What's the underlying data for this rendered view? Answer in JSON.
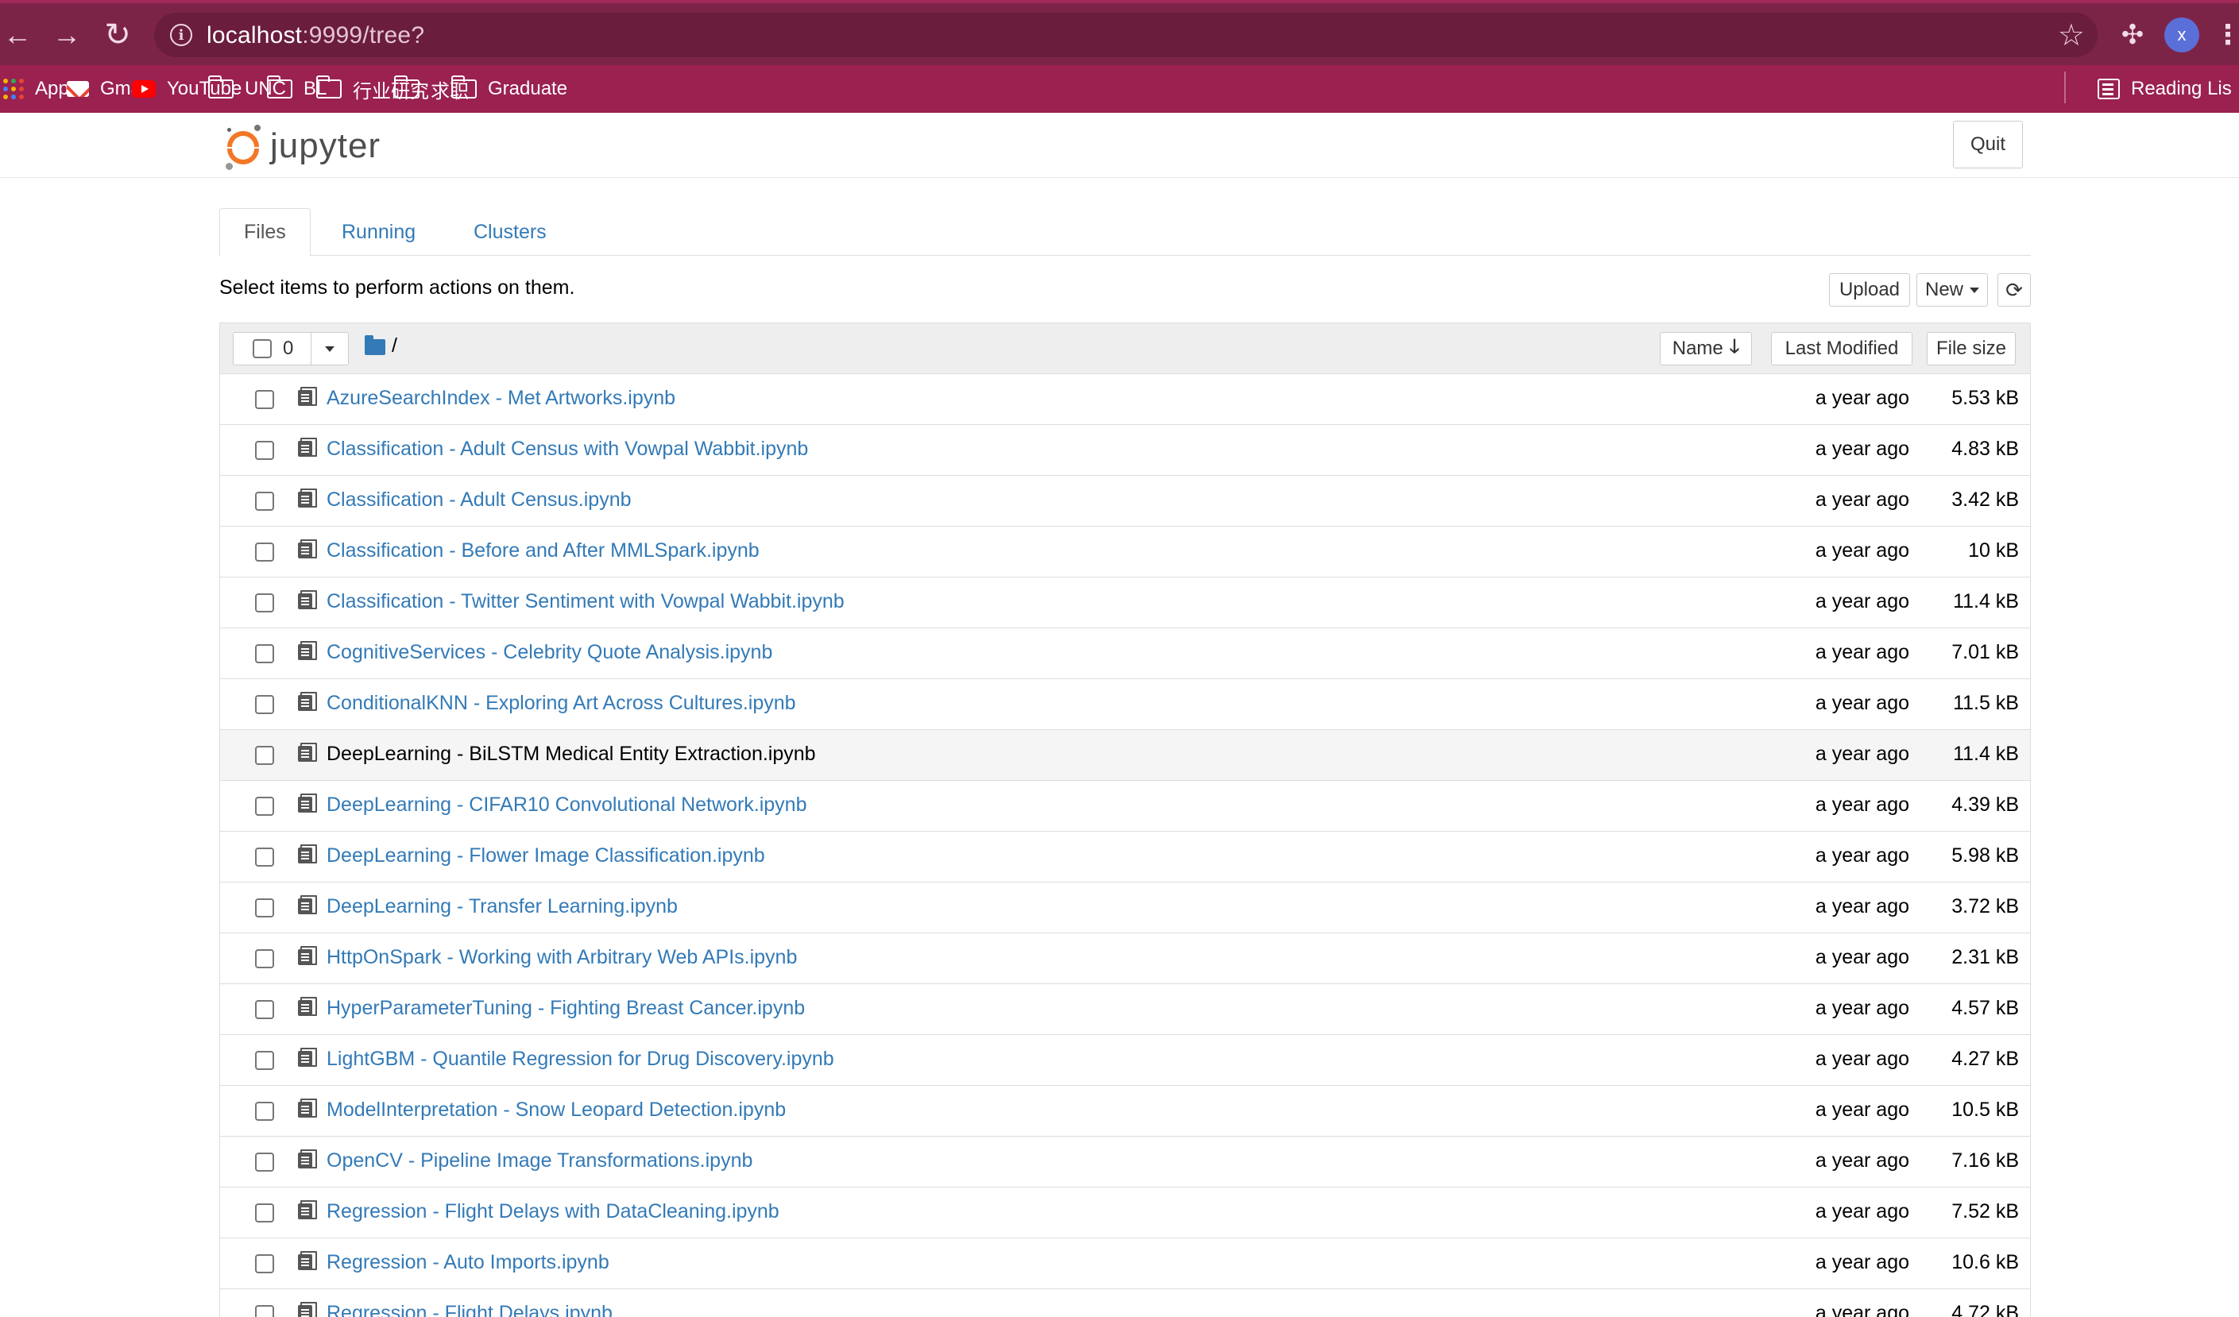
{
  "browser": {
    "url_host": "localhost",
    "url_rest": ":9999/tree?",
    "profile_initial": "x",
    "icons": [
      "back-arrow-icon",
      "forward-arrow-icon",
      "reload-icon",
      "info-icon",
      "star-icon",
      "puzzle-icon",
      "kebab-icon"
    ]
  },
  "bookmarks": [
    {
      "label": "Apps",
      "icon": "apps-grid-icon"
    },
    {
      "label": "Gmail",
      "icon": "gmail-icon"
    },
    {
      "label": "YouTube",
      "icon": "youtube-icon"
    },
    {
      "label": "UNC",
      "icon": "folder-icon"
    },
    {
      "label": "BL",
      "icon": "folder-icon"
    },
    {
      "label": "行业研究",
      "icon": "folder-icon"
    },
    {
      "label": "求职",
      "icon": "folder-icon"
    },
    {
      "label": "Graduate",
      "icon": "folder-icon"
    }
  ],
  "reading_list": "Reading Lis",
  "header": {
    "logo_text": "jupyter",
    "quit_label": "Quit"
  },
  "tabs": [
    {
      "label": "Files",
      "active": true
    },
    {
      "label": "Running",
      "active": false
    },
    {
      "label": "Clusters",
      "active": false
    }
  ],
  "toolbar": {
    "instructions": "Select items to perform actions on them.",
    "upload_label": "Upload",
    "new_label": "New",
    "refresh_icon": "⟳"
  },
  "list_header": {
    "selected_count": "0",
    "breadcrumb": "/",
    "sort_name": "Name",
    "sort_modified": "Last Modified",
    "sort_size": "File size"
  },
  "files": [
    {
      "name": "AzureSearchIndex - Met Artworks.ipynb",
      "modified": "a year ago",
      "size": "5.53 kB"
    },
    {
      "name": "Classification - Adult Census with Vowpal Wabbit.ipynb",
      "modified": "a year ago",
      "size": "4.83 kB"
    },
    {
      "name": "Classification - Adult Census.ipynb",
      "modified": "a year ago",
      "size": "3.42 kB"
    },
    {
      "name": "Classification - Before and After MMLSpark.ipynb",
      "modified": "a year ago",
      "size": "10 kB"
    },
    {
      "name": "Classification - Twitter Sentiment with Vowpal Wabbit.ipynb",
      "modified": "a year ago",
      "size": "11.4 kB"
    },
    {
      "name": "CognitiveServices - Celebrity Quote Analysis.ipynb",
      "modified": "a year ago",
      "size": "7.01 kB"
    },
    {
      "name": "ConditionalKNN - Exploring Art Across Cultures.ipynb",
      "modified": "a year ago",
      "size": "11.5 kB"
    },
    {
      "name": "DeepLearning - BiLSTM Medical Entity Extraction.ipynb",
      "modified": "a year ago",
      "size": "11.4 kB",
      "hover": true
    },
    {
      "name": "DeepLearning - CIFAR10 Convolutional Network.ipynb",
      "modified": "a year ago",
      "size": "4.39 kB"
    },
    {
      "name": "DeepLearning - Flower Image Classification.ipynb",
      "modified": "a year ago",
      "size": "5.98 kB"
    },
    {
      "name": "DeepLearning - Transfer Learning.ipynb",
      "modified": "a year ago",
      "size": "3.72 kB"
    },
    {
      "name": "HttpOnSpark - Working with Arbitrary Web APIs.ipynb",
      "modified": "a year ago",
      "size": "2.31 kB"
    },
    {
      "name": "HyperParameterTuning - Fighting Breast Cancer.ipynb",
      "modified": "a year ago",
      "size": "4.57 kB"
    },
    {
      "name": "LightGBM - Quantile Regression for Drug Discovery.ipynb",
      "modified": "a year ago",
      "size": "4.27 kB"
    },
    {
      "name": "ModelInterpretation - Snow Leopard Detection.ipynb",
      "modified": "a year ago",
      "size": "10.5 kB"
    },
    {
      "name": "OpenCV - Pipeline Image Transformations.ipynb",
      "modified": "a year ago",
      "size": "7.16 kB"
    },
    {
      "name": "Regression - Flight Delays with DataCleaning.ipynb",
      "modified": "a year ago",
      "size": "7.52 kB"
    },
    {
      "name": "Regression - Auto Imports.ipynb",
      "modified": "a year ago",
      "size": "10.6 kB"
    },
    {
      "name": "Regression - Flight Delays.ipynb",
      "modified": "a year ago",
      "size": "4.72 kB"
    }
  ]
}
